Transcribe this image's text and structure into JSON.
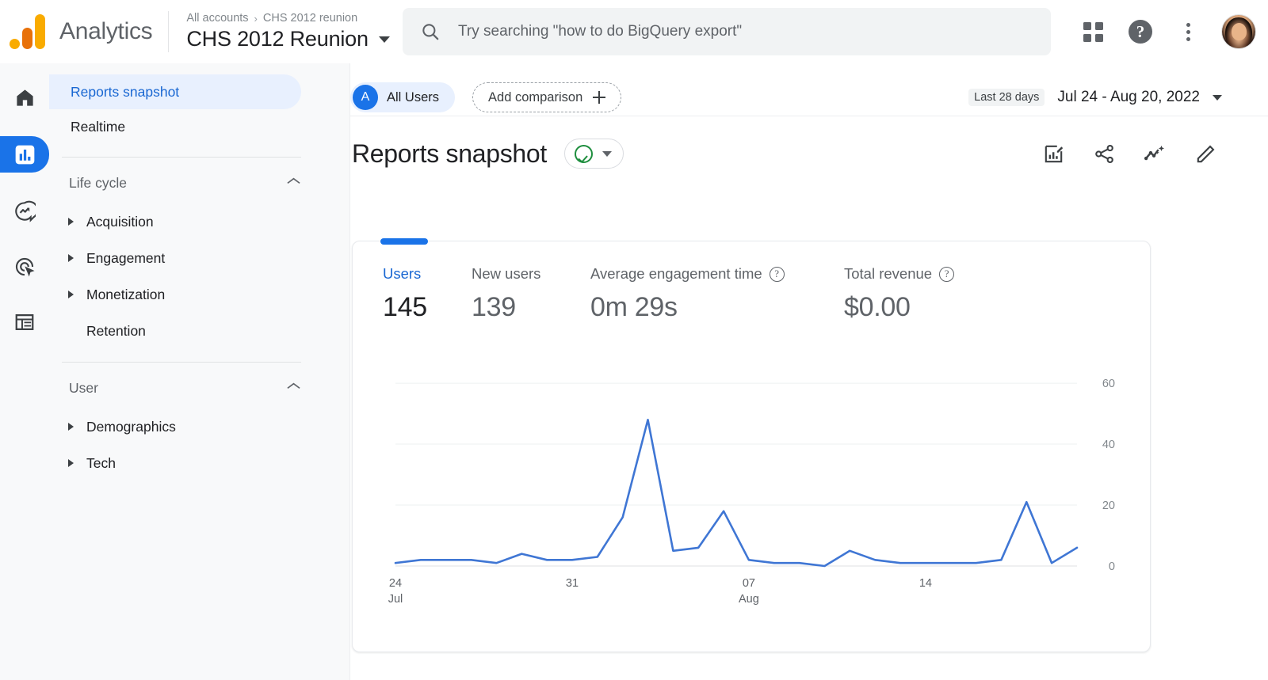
{
  "topbar": {
    "brand": "Analytics",
    "logo_colors": {
      "dot": "#F9AB00",
      "bar_mid": "#E8710A",
      "bar_tall": "#F9AB00"
    },
    "breadcrumb": {
      "root": "All accounts",
      "separator": "›",
      "current": "CHS 2012 reunion"
    },
    "account_name": "CHS 2012 Reunion",
    "search": {
      "placeholder": "Try searching \"how to do BigQuery export\"",
      "icon": "search-icon"
    },
    "actions": [
      {
        "name": "apps-grid-icon",
        "label": "Google apps"
      },
      {
        "name": "help-icon",
        "label": "?"
      },
      {
        "name": "more-options-icon",
        "label": "More options"
      },
      {
        "name": "avatar",
        "label": "Account"
      }
    ]
  },
  "rail": {
    "items": [
      {
        "icon": "home-icon",
        "label": "Home",
        "active": false
      },
      {
        "icon": "reports-bar-chart-icon",
        "label": "Reports",
        "active": true
      },
      {
        "icon": "explore-icon",
        "label": "Explore",
        "active": false
      },
      {
        "icon": "advertising-target-icon",
        "label": "Advertising",
        "active": false
      },
      {
        "icon": "configure-list-icon",
        "label": "Configure",
        "active": false
      }
    ]
  },
  "sidebar": {
    "top_items": [
      {
        "label": "Reports snapshot",
        "selected": true
      },
      {
        "label": "Realtime",
        "selected": false
      }
    ],
    "groups": [
      {
        "label": "Life cycle",
        "collapse_icon": "chevron-up-icon",
        "items": [
          {
            "label": "Acquisition",
            "expandable": true
          },
          {
            "label": "Engagement",
            "expandable": true
          },
          {
            "label": "Monetization",
            "expandable": true
          },
          {
            "label": "Retention",
            "expandable": false
          }
        ]
      },
      {
        "label": "User",
        "collapse_icon": "chevron-up-icon",
        "items": [
          {
            "label": "Demographics",
            "expandable": true
          },
          {
            "label": "Tech",
            "expandable": true
          }
        ]
      }
    ]
  },
  "main": {
    "comparison": {
      "all_users_chip": {
        "avatar_letter": "A",
        "label": "All Users"
      },
      "add_comparison": {
        "label": "Add comparison",
        "icon": "plus-icon"
      }
    },
    "date_range": {
      "badge": "Last 28 days",
      "range": "Jul 24 - Aug 20, 2022",
      "icon": "chevron-down-icon"
    },
    "page_title": "Reports snapshot",
    "status_pill": {
      "icon": "check-circle-icon",
      "dropdown_icon": "chevron-down-icon",
      "color": "#1e8e3e"
    },
    "title_actions": [
      {
        "name": "edit-report-icon",
        "label": "Customize report"
      },
      {
        "name": "share-icon",
        "label": "Share"
      },
      {
        "name": "insights-icon",
        "label": "Insights"
      },
      {
        "name": "pencil-icon",
        "label": "Edit"
      }
    ]
  },
  "card": {
    "active_tab": "Users",
    "metrics": [
      {
        "label": "Users",
        "value": "145",
        "active": true,
        "has_help": false
      },
      {
        "label": "New users",
        "value": "139",
        "active": false,
        "has_help": false
      },
      {
        "label": "Average engagement time",
        "value": "0m 29s",
        "active": false,
        "has_help": true,
        "help_icon": "help-circle-icon"
      },
      {
        "label": "Total revenue",
        "value": "$0.00",
        "active": false,
        "has_help": true,
        "help_icon": "help-circle-icon"
      }
    ]
  },
  "chart_data": {
    "type": "line",
    "title": "",
    "xlabel": "",
    "ylabel": "",
    "series": [
      {
        "name": "Users",
        "color": "#3f76d4",
        "values": [
          1,
          2,
          2,
          2,
          1,
          4,
          2,
          2,
          3,
          16,
          48,
          5,
          6,
          18,
          2,
          1,
          1,
          0,
          5,
          2,
          1,
          1,
          1,
          1,
          2,
          21,
          1,
          6
        ]
      }
    ],
    "x": [
      "24",
      "25",
      "26",
      "27",
      "28",
      "29",
      "30",
      "31",
      "01",
      "02",
      "03",
      "04",
      "05",
      "06",
      "07",
      "08",
      "09",
      "10",
      "11",
      "12",
      "13",
      "14",
      "15",
      "16",
      "17",
      "18",
      "19",
      "20"
    ],
    "xticks": [
      {
        "value": "24",
        "sub": "Jul",
        "index": 0
      },
      {
        "value": "31",
        "sub": "",
        "index": 7
      },
      {
        "value": "07",
        "sub": "Aug",
        "index": 14
      },
      {
        "value": "14",
        "sub": "",
        "index": 21
      }
    ],
    "yticks": [
      0,
      20,
      40,
      60
    ],
    "ylim": [
      0,
      66
    ],
    "grid": true,
    "legend": "none"
  }
}
